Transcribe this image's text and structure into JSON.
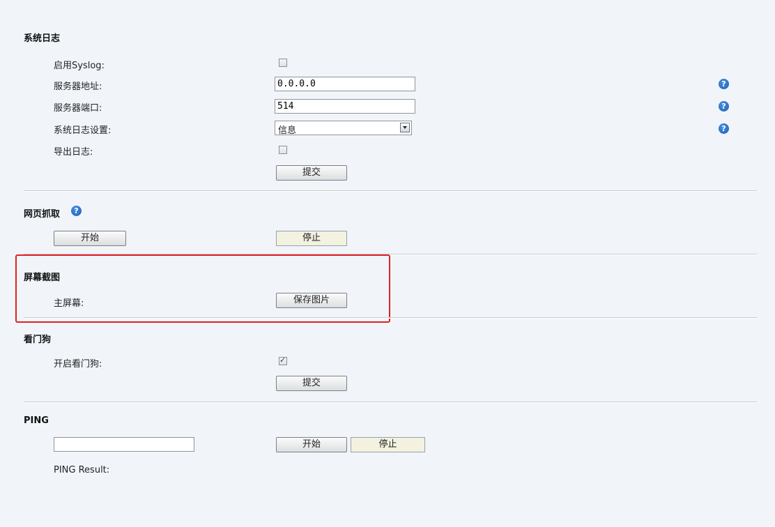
{
  "syslog": {
    "title": "系统日志",
    "enable_label": "启用Syslog:",
    "enable_checked": false,
    "server_label": "服务器地址:",
    "server_value": "0.0.0.0",
    "port_label": "服务器端口:",
    "port_value": "514",
    "level_label": "系统日志设置:",
    "level_value": "信息",
    "export_label": "导出日志:",
    "export_checked": false,
    "submit_label": "提交"
  },
  "capture": {
    "title": "网页抓取",
    "start_label": "开始",
    "stop_label": "停止"
  },
  "screenshot": {
    "title": "屏幕截图",
    "main_label": "主屏幕:",
    "save_label": "保存图片"
  },
  "watchdog": {
    "title": "看门狗",
    "enable_label": "开启看门狗:",
    "enable_checked": true,
    "submit_label": "提交"
  },
  "ping": {
    "title": "PING",
    "input_value": "",
    "start_label": "开始",
    "stop_label": "停止",
    "result_label": "PING Result:"
  },
  "colors": {
    "background": "#f1f5fa",
    "highlight_border": "#e02121",
    "help_icon": "#2a6fc9"
  }
}
